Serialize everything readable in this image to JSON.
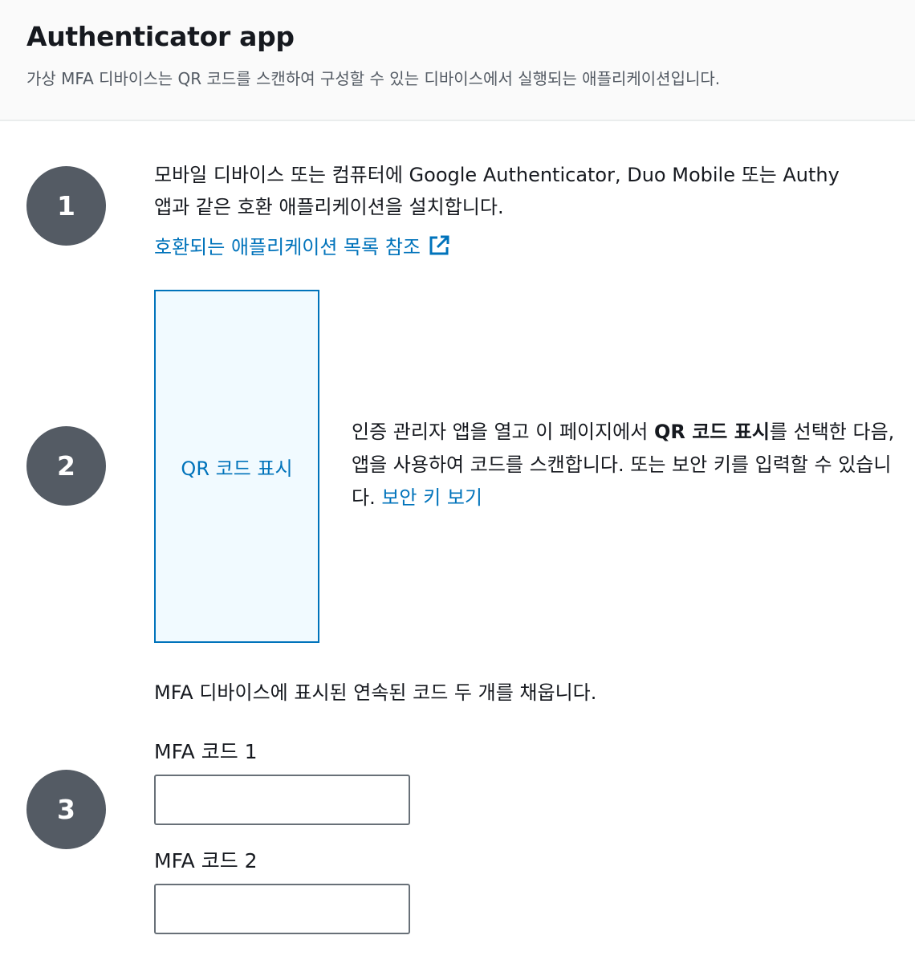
{
  "header": {
    "title": "Authenticator app",
    "description": "가상 MFA 디바이스는 QR 코드를 스캔하여 구성할 수 있는 디바이스에서 실행되는 애플리케이션입니다."
  },
  "steps": [
    {
      "number": "1",
      "text": "모바일 디바이스 또는 컴퓨터에 Google Authenticator, Duo Mobile 또는 Authy 앱과 같은 호환 애플리케이션을 설치합니다.",
      "link_label": "호환되는 애플리케이션 목록 참조",
      "link_icon": "external-link-icon"
    },
    {
      "number": "2",
      "qr_button_label": "QR 코드 표시",
      "text_before_bold": "인증 관리자 앱을 열고 이 페이지에서 ",
      "text_bold": "QR 코드 표시",
      "text_after_bold": "를 선택한 다음, 앱을 사용하여 코드를 스캔합니다. 또는 보안 키를 입력할 수 있습니다. ",
      "link_label": "보안 키 보기"
    },
    {
      "number": "3",
      "intro": "MFA 디바이스에 표시된 연속된 코드 두 개를 채웁니다.",
      "field1_label": "MFA 코드 1",
      "field1_value": "",
      "field2_label": "MFA 코드 2",
      "field2_value": ""
    }
  ],
  "colors": {
    "link": "#0073bb",
    "step_circle": "#545b64",
    "header_bg": "#fafafa",
    "qr_bg": "#f1faff"
  }
}
